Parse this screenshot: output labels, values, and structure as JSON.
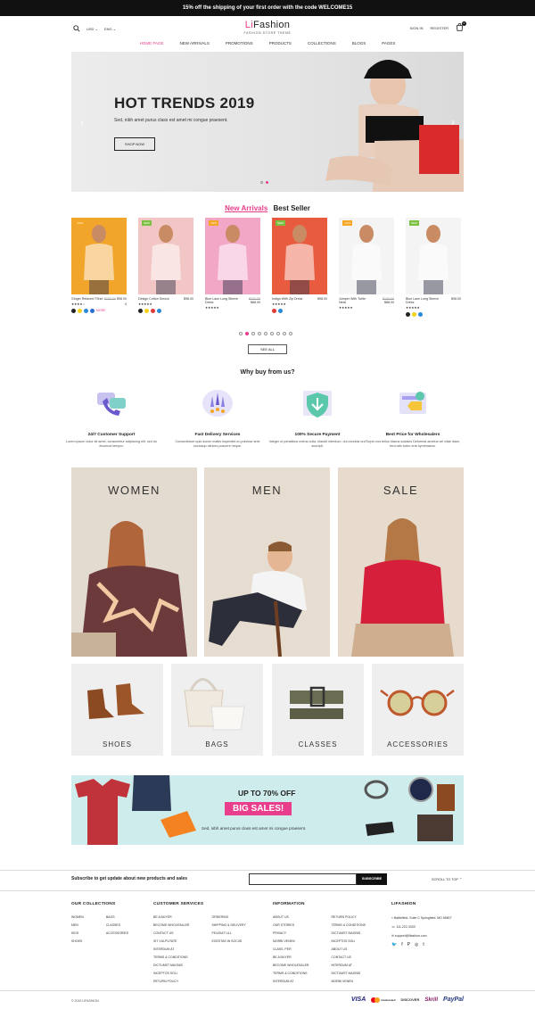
{
  "topbar": "15% off the shipping of your first order with the code WELCOME15",
  "header": {
    "logo_li": "Li",
    "logo_rest": "Fashion",
    "tagline": "FASHION STORE THEME",
    "currency": "USD",
    "language": "ENG",
    "signin": "SIGN IN",
    "register": "REGISTER",
    "cart_count": "0"
  },
  "nav": [
    "HOME PAGE",
    "NEW ARRIVALS",
    "PROMOTIONS",
    "PRODUCTS",
    "COLLECTIONS",
    "BLOGS",
    "PAGES"
  ],
  "hero": {
    "title": "HOT TRENDS 2019",
    "subtitle": "Sed, nibh amet purus class est amet mi congue praesent.",
    "button": "SHOP NOW"
  },
  "tabs": {
    "active": "New Arrivals",
    "other": "Best Seller"
  },
  "products": [
    {
      "badge": "-10%",
      "badge_color": "#f5a623",
      "name": "Ginger Relaxed TShirt",
      "old": "$100.00",
      "price": "$98.00",
      "stars": "★★★★☆",
      "rating": "4",
      "swatches": [
        "#222",
        "#f7d21b",
        "#2a8ad8",
        "#2a6fd6"
      ],
      "more": "MORE",
      "img": "#f2a52b"
    },
    {
      "badge": "NEW",
      "badge_color": "#7ac142",
      "name": "Design Cotton Smock",
      "old": "",
      "price": "$98.00",
      "stars": "★★★★★",
      "rating": "",
      "swatches": [
        "#222",
        "#f7d21b",
        "#e53935",
        "#2a8ad8"
      ],
      "more": "",
      "img": "#f3c6c6"
    },
    {
      "badge": "-10%",
      "badge_color": "#f5a623",
      "name": "Blue Lace Long Sleeve Dress",
      "old": "$100.00",
      "price": "$88.00",
      "stars": "★★★★★",
      "rating": "",
      "swatches": [],
      "more": "",
      "img": "#f3a7c7"
    },
    {
      "badge": "NEW",
      "badge_color": "#7ac142",
      "name": "Indigo With Zip Dress",
      "old": "",
      "price": "$98.00",
      "stars": "★★★★★",
      "rating": "",
      "swatches": [
        "#e53935",
        "#2a8ad8"
      ],
      "more": "",
      "img": "#e95b3e"
    },
    {
      "badge": "-10%",
      "badge_color": "#f5a623",
      "name": "Jumper With Turtle Neck",
      "old": "$100.00",
      "price": "$88.00",
      "stars": "★★★★★",
      "rating": "",
      "swatches": [],
      "more": "",
      "img": "#f4f4f4"
    },
    {
      "badge": "NEW",
      "badge_color": "#7ac142",
      "name": "Blue Lace Long Sleeve Dress",
      "old": "",
      "price": "$98.00",
      "stars": "★★★★★",
      "rating": "",
      "swatches": [
        "#222",
        "#f7d21b",
        "#2a8ad8"
      ],
      "more": "",
      "img": "#f4f4f4"
    }
  ],
  "see_all": "SEE ALL",
  "why_title": "Why buy from us?",
  "features": [
    {
      "title": "24/7 Customer Support",
      "desc": "Lorem ipsum dolor sit amet, consectetur adipiscing elit, sed do eiusmod tempor.",
      "icon": "support-icon"
    },
    {
      "title": "Fast Delivery Services",
      "desc": "Consectetuer quis donec mattis imperdiet eu pulvinar ante sociosqu ultrices posuere neque.",
      "icon": "rocket-icon"
    },
    {
      "title": "100% Secure Payment",
      "desc": "Integer ut penatibus metus nulla, blandit interdum, dui conubia orci suscipit.",
      "icon": "shield-icon"
    },
    {
      "title": "Best Price for Wholesalers",
      "desc": "Turpis nos tellus blacus sodales Deturmat ametus vel vitae diam, fera tafo tortor erat hymenaeos.",
      "icon": "price-tag-icon"
    }
  ],
  "categories": [
    "WOMEN",
    "MEN",
    "SALE"
  ],
  "subcategories": [
    "SHOES",
    "BAGS",
    "CLASSES",
    "ACCESSORIES"
  ],
  "banner": {
    "line1": "UP TO 70% OFF",
    "line2": "BIG SALES!",
    "line3": "Sed, nibh amet purus class est amet mi congue praesent."
  },
  "subscribe": {
    "label": "Subscribe to get update about new products and sales",
    "placeholder": "",
    "button": "SUBSCRIBE",
    "scroll": "SCROLL TO TOP"
  },
  "footer": {
    "collections": {
      "title": "OUR COLLECTIONS",
      "col1": [
        "WOMEN",
        "MEN",
        "KIDS",
        "SHOES"
      ],
      "col2": [
        "BAGS",
        "CLASSES",
        "ACCESSORIES"
      ]
    },
    "services": {
      "title": "CUSTOMER SERVICES",
      "col1": [
        "BE A BUYER",
        "BECOME WHOLESALER",
        "CONTACT US",
        "SIT VULPUTATE",
        "INTERDUM AT",
        "TERMS & CONDITIONS",
        "DICTUMST MAGNIS",
        "INCEPTOS SOLI",
        "RETURN POLICY"
      ],
      "col2": [
        "ORDERING",
        "SHIPPING & DELIVERY",
        "FEUGIAT ULL",
        "EGESTAS IN SOCIIS"
      ]
    },
    "information": {
      "title": "INFORMATION",
      "col1": [
        "ABOUT US",
        "OUR STORIES",
        "PRIVACY",
        "MORBI VENEN",
        "CLASS. PER",
        "BE A BUYER",
        "BECOME WHOLESALER",
        "TERMS & CONDITIONS",
        "INTERDUM AT"
      ],
      "col2": [
        "RETURN POLICY",
        "TERMS & CONDITIONS",
        "DICTUMST MAGNIS",
        "INCEPTOS SOLI",
        "ABOUT US",
        "CONTACT US",
        "INTERDUM AT",
        "DICTUMST MAGNIS",
        "MORBI VENEN"
      ]
    },
    "lifashion": {
      "title": "LIFASHION",
      "address": "Battlefield, Suite C Springfield, MO 65807",
      "phone": "111-222-3333",
      "email": "support@lifashion.com"
    }
  },
  "copyright": "© 2019 LIFASHION",
  "payments": [
    "VISA",
    "mastercard",
    "DISCOVER",
    "Skrill",
    "PayPal"
  ]
}
